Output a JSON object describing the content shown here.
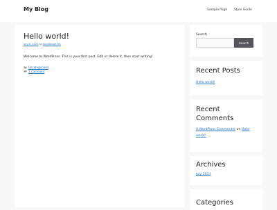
{
  "header": {
    "site_title": "My Blog",
    "nav": [
      "Sample Page",
      "Style Guide"
    ]
  },
  "post": {
    "title": "Hello world!",
    "meta_date": "July 8, 2023",
    "meta_by": "by",
    "meta_author": "bandbloge791",
    "content": "Welcome to WordPress. This is your first post. Edit or delete it, then start writing!",
    "category": "Uncategorized",
    "comments": "1 Comment"
  },
  "sidebar": {
    "search": {
      "label": "Search",
      "value": "",
      "placeholder": "",
      "button": "Search"
    },
    "recent_posts": {
      "heading": "Recent Posts",
      "items": [
        "Hello world!"
      ]
    },
    "recent_comments": {
      "heading_line1": "Recent",
      "heading_line2": "Comments",
      "commenter": "A WordPress Commenter",
      "on": "on",
      "post_line1": "Hello",
      "post_line2": "world!"
    },
    "archives": {
      "heading": "Archives",
      "items": [
        "July 2023"
      ]
    },
    "categories": {
      "heading": "Categories"
    }
  },
  "colors": {
    "link": "#1e73be",
    "button": "#55555e",
    "background": "#f7f8f9"
  },
  "icons": [
    "folder-icon",
    "comment-icon"
  ]
}
